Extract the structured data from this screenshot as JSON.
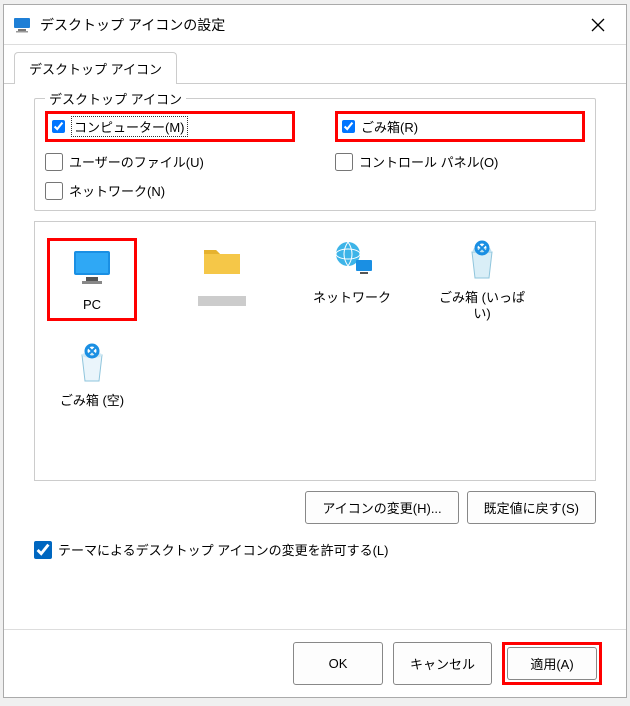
{
  "title": "デスクトップ アイコンの設定",
  "tab": {
    "label": "デスクトップ アイコン"
  },
  "fieldset": {
    "legend": "デスクトップ アイコン",
    "checkboxes": {
      "computer": {
        "label": "コンピューター(M)",
        "checked": true
      },
      "recycle": {
        "label": "ごみ箱(R)",
        "checked": true
      },
      "userfiles": {
        "label": "ユーザーのファイル(U)",
        "checked": false
      },
      "controlpanel": {
        "label": "コントロール パネル(O)",
        "checked": false
      },
      "network": {
        "label": "ネットワーク(N)",
        "checked": false
      }
    }
  },
  "icons": {
    "pc": "PC",
    "folder": "",
    "network": "ネットワーク",
    "trashfull": "ごみ箱 (いっぱい)",
    "trashempty": "ごみ箱 (空)"
  },
  "buttons": {
    "changeicon": "アイコンの変更(H)...",
    "restoredefault": "既定値に戻す(S)",
    "ok": "OK",
    "cancel": "キャンセル",
    "apply": "適用(A)"
  },
  "themeCheckbox": {
    "label": "テーマによるデスクトップ アイコンの変更を許可する(L)",
    "checked": true
  }
}
